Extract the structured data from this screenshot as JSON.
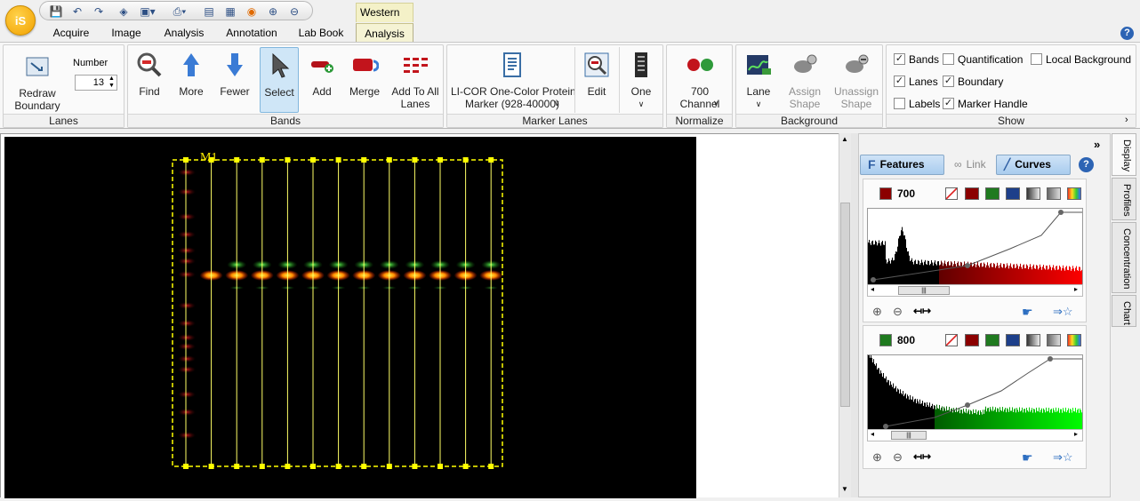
{
  "app": {
    "logo": "iS",
    "context_tab": "Western"
  },
  "quick_access": [
    "save-icon",
    "undo-icon",
    "redo-icon",
    "settings-icon",
    "image-icon",
    "print-icon",
    "export-icon",
    "grid-icon",
    "rss-icon",
    "zoom-in-icon",
    "zoom-out-icon"
  ],
  "tabs": [
    {
      "label": "Acquire"
    },
    {
      "label": "Image"
    },
    {
      "label": "Analysis"
    },
    {
      "label": "Annotation"
    },
    {
      "label": "Lab Book"
    },
    {
      "label": "Analysis",
      "active": true
    }
  ],
  "ribbon": {
    "lanes": {
      "label": "Lanes",
      "redraw": "Redraw\nBoundary",
      "number_label": "Number",
      "number_value": "13"
    },
    "bands": {
      "label": "Bands",
      "find": "Find",
      "more": "More",
      "fewer": "Fewer",
      "select": "Select",
      "add": "Add",
      "merge": "Merge",
      "add_to_all": "Add To All\nLanes"
    },
    "marker_lanes": {
      "label": "Marker Lanes",
      "marker": "LI-COR One-Color Protein\nMarker (928-40000)",
      "edit": "Edit",
      "one": "One"
    },
    "normalize": {
      "label": "Normalize",
      "channel": "700\nChannel"
    },
    "background": {
      "label": "Background",
      "lane": "Lane",
      "assign": "Assign\nShape",
      "unassign": "Unassign\nShape"
    },
    "show": {
      "label": "Show",
      "items": [
        {
          "label": "Bands",
          "checked": true
        },
        {
          "label": "Quantification",
          "checked": false
        },
        {
          "label": "Local Background",
          "checked": false
        },
        {
          "label": "Lanes",
          "checked": true
        },
        {
          "label": "Boundary",
          "checked": true
        },
        {
          "label": "Labels",
          "checked": false
        },
        {
          "label": "Marker Handle",
          "checked": true
        }
      ]
    }
  },
  "blot": {
    "marker_label": "M1",
    "lane_count": 13
  },
  "panel": {
    "toolbar": {
      "features": "Features",
      "link": "Link",
      "curves": "Curves"
    },
    "channels": [
      {
        "name": "700",
        "color": "#8b0000"
      },
      {
        "name": "800",
        "color": "#1f7a1f"
      }
    ],
    "side_tabs": [
      "Display",
      "Profiles",
      "Concentration",
      "Chart"
    ]
  },
  "colors": {
    "accent": "#fdf200",
    "red_band": "#ff2200",
    "green_band": "#33cc33"
  }
}
